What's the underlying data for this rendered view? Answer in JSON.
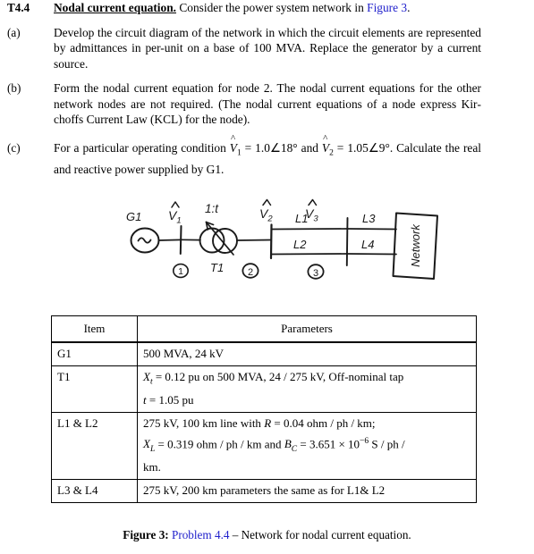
{
  "problem": {
    "number": "T4.4",
    "title": "Nodal current equation.",
    "intro_rest_1": " Consider the power system network in ",
    "intro_link": "Figure 3",
    "intro_rest_2": ".",
    "parts": [
      {
        "label": "(a)",
        "text": "Develop the circuit diagram of the network in which the circuit elements are repre­sented by admittances in per-unit on a base of 100 MVA. Replace the generator by a current source."
      },
      {
        "label": "(b)",
        "text": "Form the nodal current equation for node 2. The nodal current equations for the other network nodes are not required. (The nodal current equations of a node express Kir­choffs Current Law (KCL) for the node)."
      },
      {
        "label": "(c)",
        "text_before": "For a particular operating condition ",
        "v1_symbol": "V",
        "v1_sub": "1",
        "eq1": " = ",
        "v1_value": "1.0∠18°",
        "joiner": " and ",
        "v2_symbol": "V",
        "v2_sub": "2",
        "eq2": " = ",
        "v2_value": "1.05∠9°",
        "text_after": ". Calculate the real and reactive power supplied by G1."
      }
    ]
  },
  "figure": {
    "generator_label": "G1",
    "generator_symbol": "~",
    "v1_label": "V",
    "v1_sub": "1",
    "v2_label": "V",
    "v2_sub": "2",
    "v3_label": "V",
    "v3_sub": "3",
    "tap_ratio_label": "1:t",
    "transformer_label": "T1",
    "node1": "1",
    "node2": "2",
    "node3": "3",
    "line_l1": "L1",
    "line_l2": "L2",
    "line_l3": "L3",
    "line_l4": "L4",
    "network_box_label": "Network"
  },
  "table": {
    "headers": [
      "Item",
      "Parameters"
    ],
    "rows": [
      {
        "item": "G1",
        "lines": [
          {
            "plain": "500 MVA, 24 kV"
          }
        ]
      },
      {
        "item": "T1",
        "lines": [
          {
            "var": "X",
            "var_sub": "t",
            "rest": " =  0.12  pu on 500 MVA, 24 / 275 kV, Off-nominal tap"
          },
          {
            "var": "t",
            "var_sub": "",
            "rest": " =  1.05  pu"
          }
        ]
      },
      {
        "item": "L1 & L2",
        "lines": [
          {
            "pre": "275 kV, 100 km line with ",
            "var": "R",
            "var_sub": "",
            "rest": " =  0.04  ohm / ph / km;"
          },
          {
            "var": "X",
            "var_sub": "L",
            "mid": " =  0.319  ohm / ph / km and ",
            "var2": "B",
            "var2_sub": "C",
            "rest2": " =  3.651 × 10",
            "exponent": "−6",
            "tail": " S / ph /"
          },
          {
            "plain": "km."
          }
        ]
      },
      {
        "item": "L3 & L4",
        "lines": [
          {
            "plain": "275 kV, 200 km parameters the same as for L1& L2"
          }
        ]
      }
    ]
  },
  "caption": {
    "figure_label": "Figure 3:",
    "link_text": " Problem 4.4",
    "rest": " – Network for nodal current equation."
  },
  "colors": {
    "link": "#2222cc",
    "text": "#000000",
    "background": "#ffffff"
  }
}
